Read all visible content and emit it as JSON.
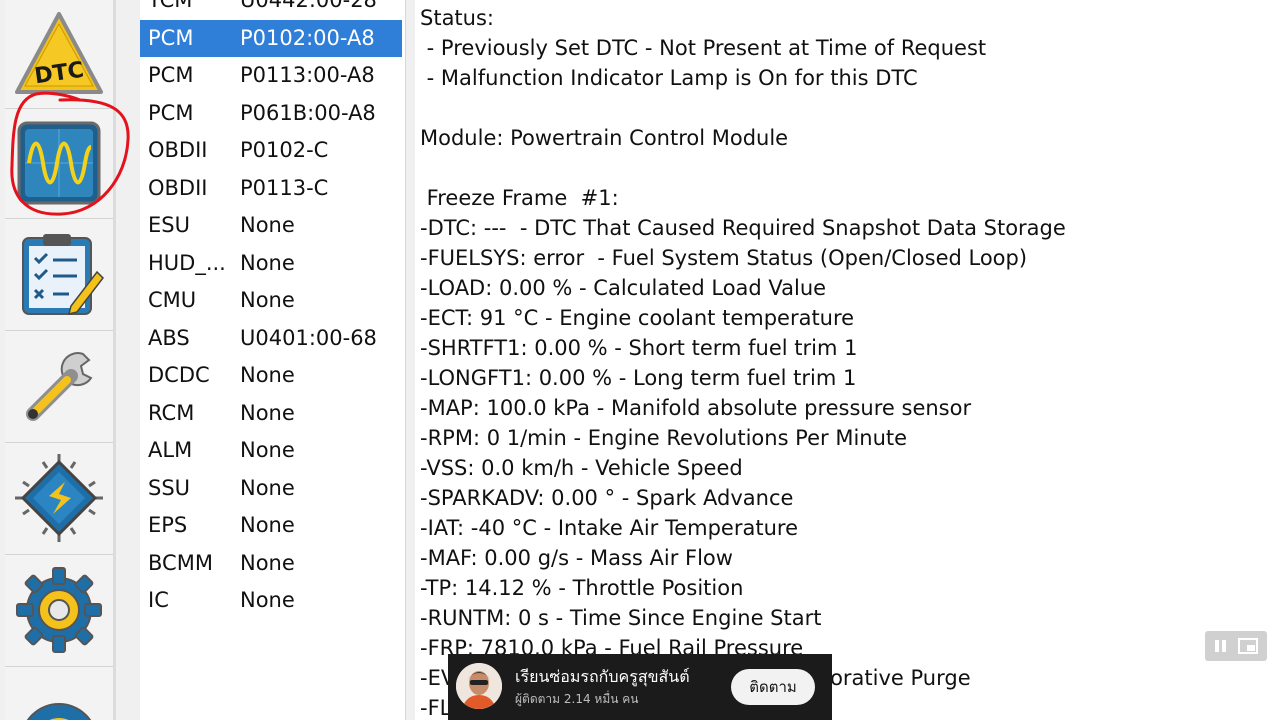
{
  "list": {
    "selected_index": 1,
    "rows": [
      {
        "module": "TCM",
        "code": "U0442:00-28"
      },
      {
        "module": "PCM",
        "code": "P0102:00-A8"
      },
      {
        "module": "PCM",
        "code": "P0113:00-A8"
      },
      {
        "module": "PCM",
        "code": "P061B:00-A8"
      },
      {
        "module": "OBDII",
        "code": "P0102-C"
      },
      {
        "module": "OBDII",
        "code": "P0113-C"
      },
      {
        "module": "ESU",
        "code": "None"
      },
      {
        "module": "HUD_...",
        "code": "None"
      },
      {
        "module": "CMU",
        "code": "None"
      },
      {
        "module": "ABS",
        "code": "U0401:00-68"
      },
      {
        "module": "DCDC",
        "code": "None"
      },
      {
        "module": "RCM",
        "code": "None"
      },
      {
        "module": "ALM",
        "code": "None"
      },
      {
        "module": "SSU",
        "code": "None"
      },
      {
        "module": "EPS",
        "code": "None"
      },
      {
        "module": "BCMM",
        "code": "None"
      },
      {
        "module": "IC",
        "code": "None"
      }
    ]
  },
  "toolbar": {
    "dtc_label": "DTC",
    "icons": [
      "dtc-warning-icon",
      "oscilloscope-icon",
      "checklist-icon",
      "wrench-icon",
      "module-chip-icon",
      "settings-gear-icon",
      "partial-icon"
    ]
  },
  "detail": {
    "lines": [
      "Status:",
      " - Previously Set DTC - Not Present at Time of Request",
      " - Malfunction Indicator Lamp is On for this DTC",
      "",
      "Module: Powertrain Control Module",
      "",
      " Freeze Frame  #1:",
      "-DTC: ---  - DTC That Caused Required Snapshot Data Storage",
      "-FUELSYS: error  - Fuel System Status (Open/Closed Loop)",
      "-LOAD: 0.00 % - Calculated Load Value",
      "-ECT: 91 °C - Engine coolant temperature",
      "-SHRTFT1: 0.00 % - Short term fuel trim 1",
      "-LONGFT1: 0.00 % - Long term fuel trim 1",
      "-MAP: 100.0 kPa - Manifold absolute pressure sensor",
      "-RPM: 0 1/min - Engine Revolutions Per Minute",
      "-VSS: 0.0 km/h - Vehicle Speed",
      "-SPARKADV: 0.00 ° - Spark Advance",
      "-IAT: -40 °C - Intake Air Temperature",
      "-MAF: 0.00 g/s - Mass Air Flow",
      "-TP: 14.12 % - Throttle Position",
      "-RUNTM: 0 s - Time Since Engine Start",
      "-FRP: 7810.0 kPa - Fuel Rail Pressure",
      "-EVAP_PCT: 0.00 % - Commanded Evaporative Purge",
      "-FL"
    ]
  },
  "overlay": {
    "channel_name": "เรียนซ่อมรถกับครูสุขสันต์",
    "subscribers": "ผู้ติดตาม 2.14 หมื่น คน",
    "follow_label": "ติดตาม"
  },
  "colors": {
    "selection": "#2f7ed8",
    "annotation": "#e3121c",
    "icon_blue": "#1e6fa8",
    "dtc_yellow": "#f4c21a"
  }
}
